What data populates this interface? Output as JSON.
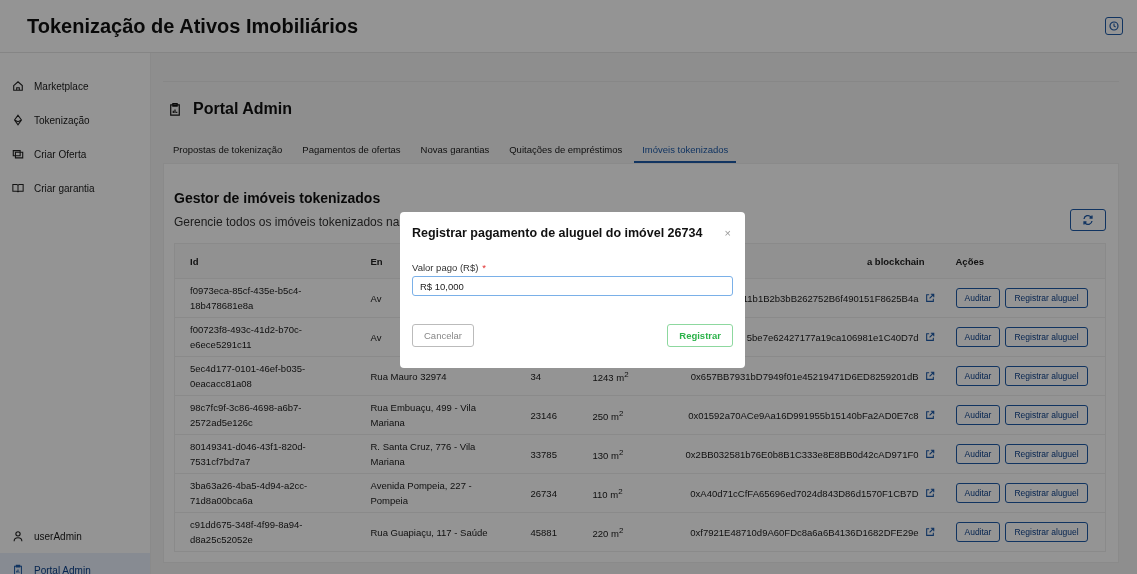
{
  "app": {
    "title": "Tokenização de Ativos Imobiliários"
  },
  "sidebar": {
    "items": [
      {
        "label": "Marketplace",
        "selected": false
      },
      {
        "label": "Tokenização",
        "selected": false
      },
      {
        "label": "Criar Oferta",
        "selected": false
      },
      {
        "label": "Criar garantia",
        "selected": false
      }
    ],
    "bottom_items": [
      {
        "label": "userAdmin",
        "selected": false
      },
      {
        "label": "Portal Admin",
        "selected": true
      }
    ]
  },
  "page": {
    "title": "Portal Admin"
  },
  "tabs": [
    {
      "label": "Propostas de tokenização",
      "selected": false
    },
    {
      "label": "Pagamentos de ofertas",
      "selected": false
    },
    {
      "label": "Novas garantias",
      "selected": false
    },
    {
      "label": "Quitações de empréstimos",
      "selected": false
    },
    {
      "label": "Imóveis tokenizados",
      "selected": true
    }
  ],
  "card": {
    "title": "Gestor de imóveis tokenizados",
    "description": "Gerencie todos os imóveis tokenizados na"
  },
  "table": {
    "columns": {
      "id": "Id",
      "address": "En",
      "hash": "a blockchain",
      "actions": "Ações"
    },
    "rows": [
      {
        "id": "f0973eca-85cf-435e-b5c4-18b478681e8a",
        "address": "Av",
        "hash": "11b1B2b3bB262752B6f490151F8625B4a",
        "actions": [
          "Auditar",
          "Registrar aluguel"
        ]
      },
      {
        "id": "f00723f8-493c-41d2-b70c-e6ece5291c11",
        "address": "Av",
        "hash": "5be7e62427177a19ca106981e1C40D7d",
        "actions": [
          "Auditar",
          "Registrar aluguel"
        ]
      },
      {
        "id": "5ec4d177-0101-46ef-b035-0eacacc81a08",
        "address": "Rua Mauro 32974",
        "number": "34",
        "area": "1243 m$^{2}$",
        "hash": "0x657BB7931bD7949f01e45219471D6ED8259201dB",
        "actions": [
          "Auditar",
          "Registrar aluguel"
        ]
      },
      {
        "id": "98c7fc9f-3c86-4698-a6b7-2572ad5e126c",
        "address": "Rua Embuaçu, 499 - Vila Mariana",
        "number": "23146",
        "area": "250 m$^{2}$",
        "hash": "0x01592a70ACe9Aa16D991955b15140bFa2AD0E7c8",
        "actions": [
          "Auditar",
          "Registrar aluguel"
        ]
      },
      {
        "id": "80149341-d046-43f1-820d-7531cf7bd7a7",
        "address": "R. Santa Cruz, 776 - Vila Mariana",
        "number": "33785",
        "area": "130 m$^{2}$",
        "hash": "0x2BB032581b76E0b8B1C333e8E8BB0d42cAD971F0",
        "actions": [
          "Auditar",
          "Registrar aluguel"
        ]
      },
      {
        "id": "3ba63a26-4ba5-4d94-a2cc-71d8a00bca6a",
        "address": "Avenida Pompeia, 227 - Pompeia",
        "number": "26734",
        "area": "110 m$^{2}$",
        "hash": "0xA40d71cCfFA65696ed7024d843D86d1570F1CB7D",
        "actions": [
          "Auditar",
          "Registrar aluguel"
        ]
      },
      {
        "id": "c91dd675-348f-4f99-8a94-d8a25c52052e",
        "address": "Rua Guapiaçu, 117 - Saúde",
        "number": "45881",
        "area": "220 m$^{2}$",
        "hash": "0xf7921E48710d9A60FDc8a6a6B4136D1682DFE29e",
        "actions": [
          "Auditar",
          "Registrar aluguel"
        ]
      }
    ]
  },
  "modal": {
    "title": "Registrar pagamento de aluguel do imóvel 26734",
    "close": "×",
    "field": {
      "label": "Valor pago (R$)",
      "required_mark": "*",
      "value": "R$ 10,000"
    },
    "buttons": [
      "Cancelar",
      "Registrar"
    ]
  }
}
